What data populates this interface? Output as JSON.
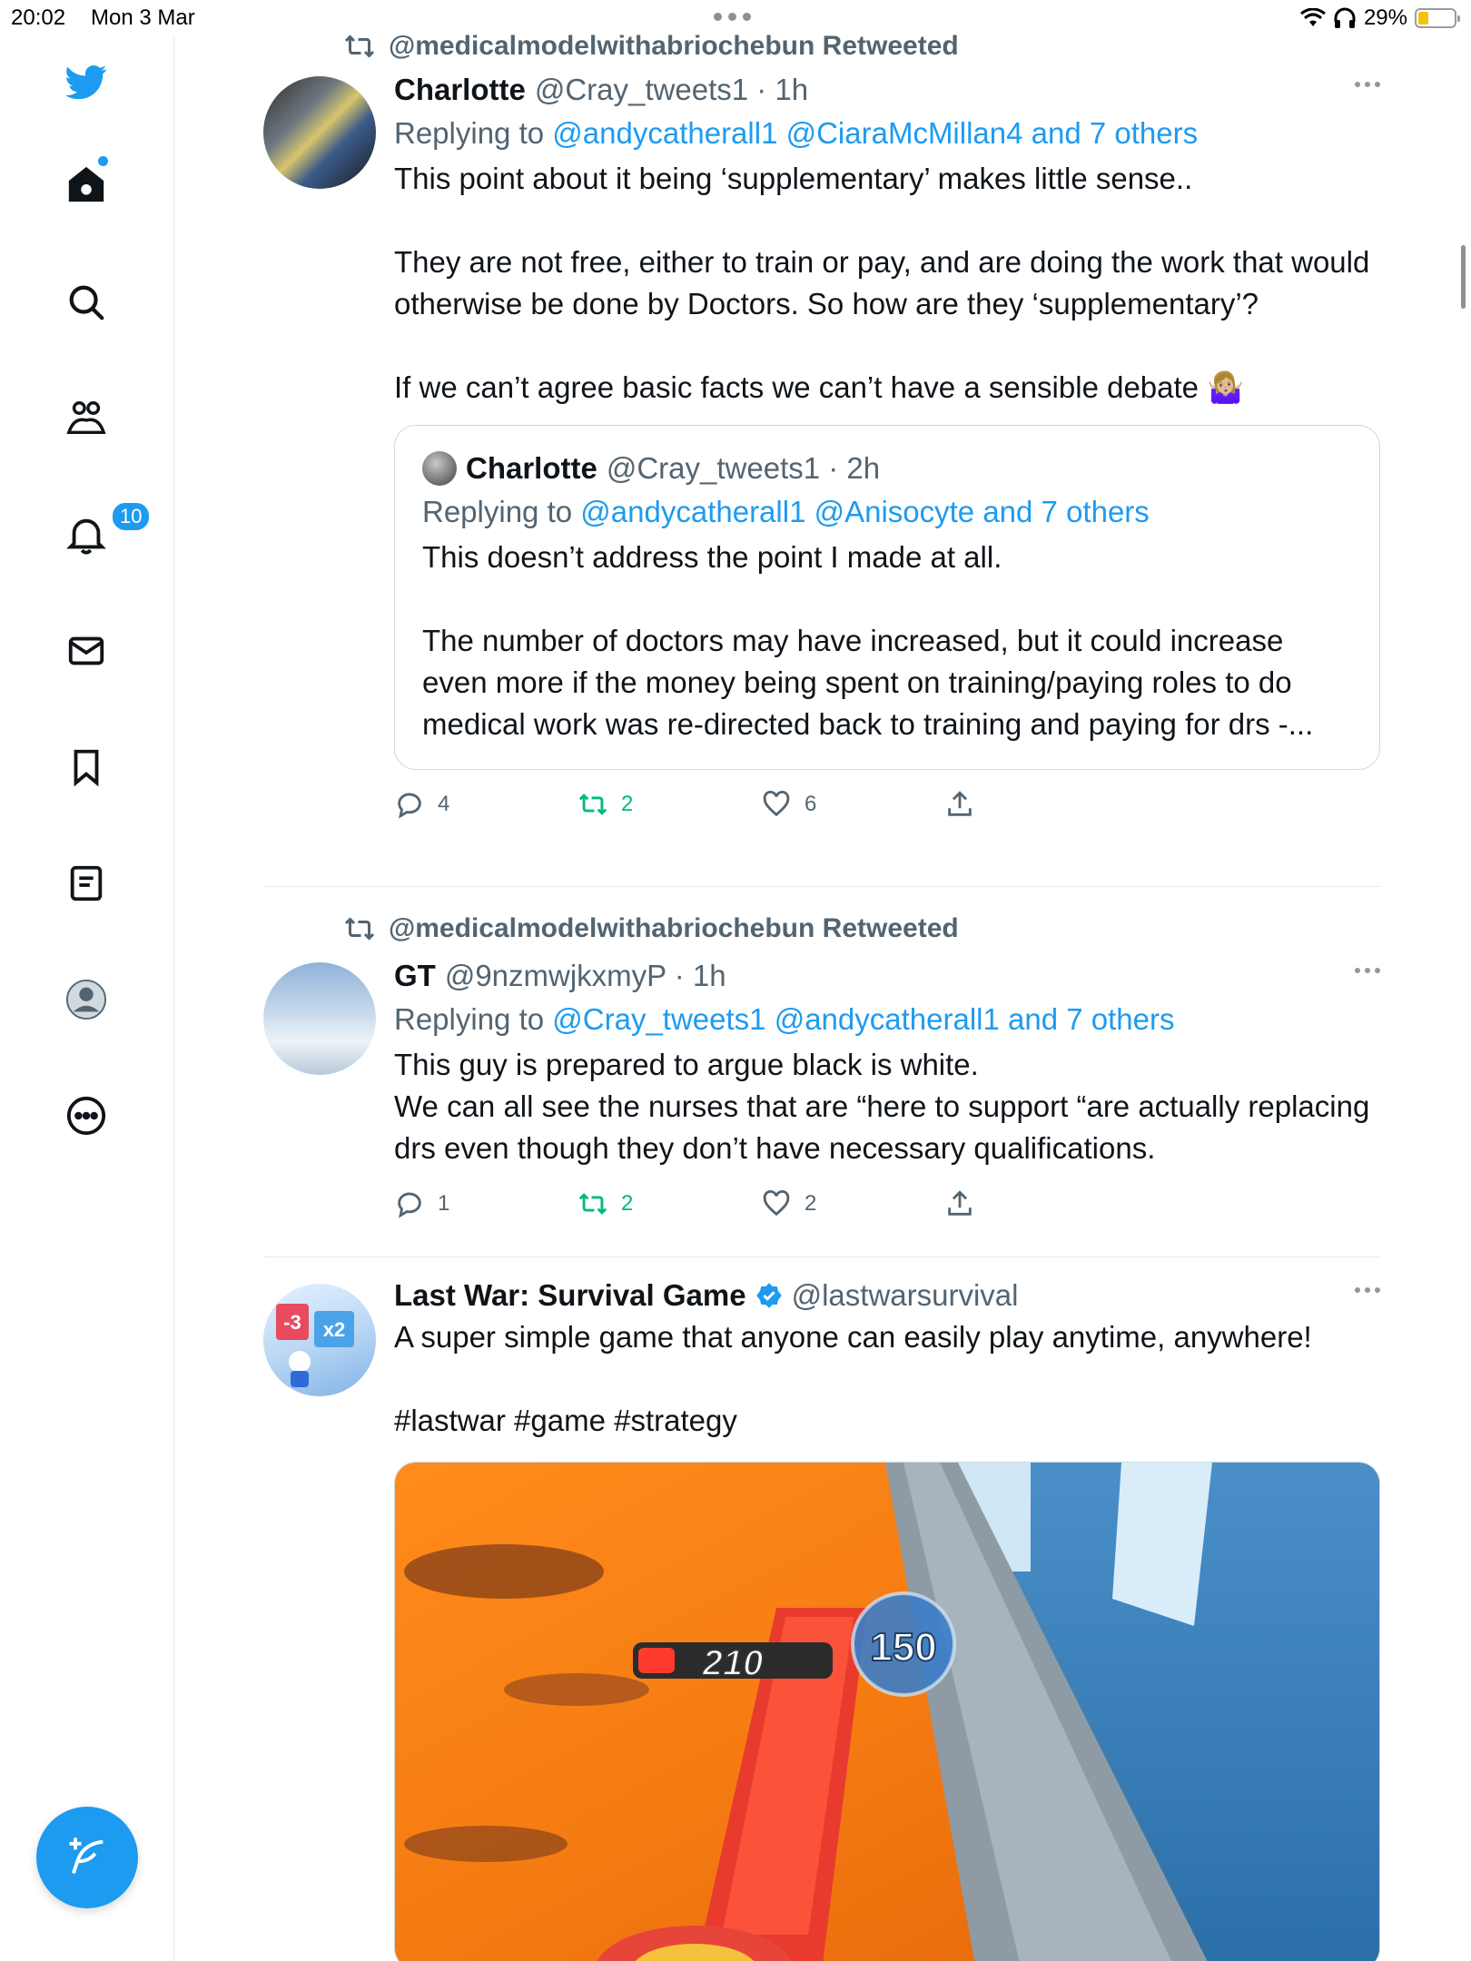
{
  "status_bar": {
    "time": "20:02",
    "date": "Mon 3 Mar",
    "battery": "29%",
    "battery_level": 0.29
  },
  "sidebar": {
    "notifications_badge": "10"
  },
  "tweets": [
    {
      "retweeted_by": "@medicalmodelwithabriochebun Retweeted",
      "name": "Charlotte",
      "handle_time": "@Cray_tweets1 · 1h",
      "reply_prefix": "Replying to",
      "reply_links": "@andycatherall1 @CiaraMcMillan4 and 7 others",
      "text": "This point about it being ‘supplementary’ makes little sense..\n\nThey are not free, either to train or pay, and are doing the work that would otherwise be done by Doctors. So how are they ‘supplementary’?\n\nIf we can’t agree basic facts we can’t have a sensible debate 🤷🏼‍♀️",
      "quote": {
        "name": "Charlotte",
        "handle_time": "@Cray_tweets1 · 2h",
        "reply_prefix": "Replying to",
        "reply_links": "@andycatherall1 @Anisocyte and 7 others",
        "text": "This doesn’t address the point I made at all.\n\nThe number of doctors may have increased, but it could increase even more if the money being spent on training/paying roles to do medical work was re-directed back to training and paying for drs -..."
      },
      "replies": "4",
      "retweets": "2",
      "likes": "6"
    },
    {
      "retweeted_by": "@medicalmodelwithabriochebun Retweeted",
      "name": "GT",
      "handle_time": "@9nzmwjkxmyP · 1h",
      "reply_prefix": "Replying to",
      "reply_links": "@Cray_tweets1 @andycatherall1 and 7 others",
      "text": "This guy is prepared to argue black is white.\nWe can all see the nurses that are “here to support “are actually replacing drs even though they don’t have necessary qualifications.",
      "replies": "1",
      "retweets": "2",
      "likes": "2"
    },
    {
      "name": "Last War: Survival Game",
      "handle": "@lastwarsurvival",
      "text": "A super simple game that anyone can easily play anytime, anywhere!",
      "hashtags": "#lastwar #game #strategy",
      "media_counter_top": "210",
      "media_counter_right": "150",
      "avatar_labels": {
        "a": "-3",
        "b": "x2"
      }
    }
  ],
  "colors": {
    "accent": "#1d9bf0",
    "retweet_green": "#00ba7c",
    "muted": "#536471"
  }
}
